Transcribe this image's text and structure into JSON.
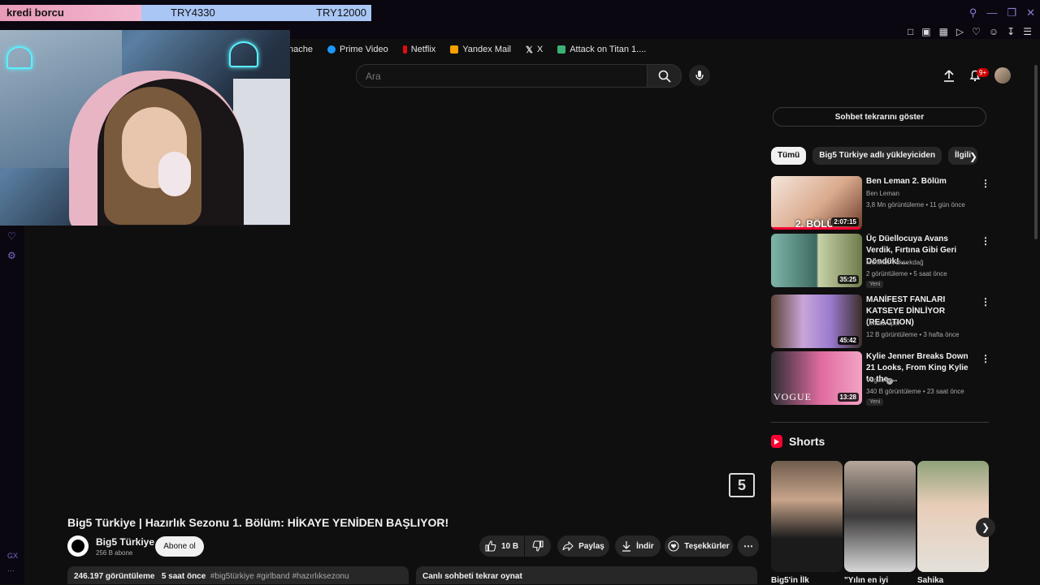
{
  "overlay": {
    "donation_label": "kredi borcu",
    "amount_current": "TRY4330",
    "amount_goal": "TRY12000"
  },
  "browser": {
    "bookmarks": [
      {
        "label": "nache",
        "color": "#0f0f0f"
      },
      {
        "label": "Prime Video",
        "color": "#1a98ff"
      },
      {
        "label": "Netflix",
        "color": "#e50914"
      },
      {
        "label": "Yandex Mail",
        "color": "#f7a000"
      },
      {
        "label": "X",
        "color": "#0f0f0f"
      },
      {
        "label": "Attack on Titan 1....",
        "color": "#3bb273"
      }
    ]
  },
  "search": {
    "placeholder": "Ara"
  },
  "header": {
    "notification_count": "9+"
  },
  "video": {
    "title": "Big5 Türkiye | Hazırlık Sezonu 1. Bölüm: HİKAYE YENİDEN BAŞLIYOR!",
    "channel_logo": "5",
    "channel_name": "Big5 Türkiye",
    "subscribers": "256 B abone",
    "subscribe_label": "Abone ol",
    "like_count": "10 B",
    "share_label": "Paylaş",
    "download_label": "İndir",
    "thanks_label": "Teşekkürler",
    "views": "246.197 görüntüleme",
    "posted": "5 saat önce",
    "hashtags": "#big5türkiye #girlband #hazırlıksezonu",
    "live_replay": "Canlı sohbeti tekrar oynat"
  },
  "sidebar": {
    "show_chat": "Sohbet tekrarını göster",
    "chips": [
      "Tümü",
      "Big5 Türkiye adlı yükleyiciden",
      "İlgili"
    ],
    "recommendations": [
      {
        "title": "Ben Leman 2. Bölüm",
        "channel": "Ben Leman",
        "meta": "3,8 Mn görüntüleme • 11 gün önce",
        "duration": "2:07:15",
        "badge": "",
        "overlay": "2. BÖLÜ"
      },
      {
        "title": "Üç Düellocuya Avans Verdik, Fırtına Gibi Geri Döndük! ...",
        "channel": "Mehmet Yüksekdağ",
        "meta": "2 görüntüleme • 5 saat önce",
        "duration": "35:25",
        "badge": "Yeni",
        "overlay": ""
      },
      {
        "title": "MANİFEST FANLARI KATSEYE DİNLİYOR (REACTION)",
        "channel": "UmutvAlper",
        "meta": "12 B görüntüleme • 3 hafta önce",
        "duration": "45:42",
        "badge": "",
        "overlay": ""
      },
      {
        "title": "Kylie Jenner Breaks Down 21 Looks, From King Kylie to the ...",
        "channel": "Vogue",
        "meta": "340 B görüntüleme • 23 saat önce",
        "duration": "13:28",
        "badge": "Yeni",
        "overlay": "VOGUE"
      }
    ],
    "shorts_heading": "Shorts",
    "shorts": [
      {
        "title": "Big5'in İlk"
      },
      {
        "title": "\"Yılın en iyi"
      },
      {
        "title": "Sahika"
      }
    ]
  }
}
